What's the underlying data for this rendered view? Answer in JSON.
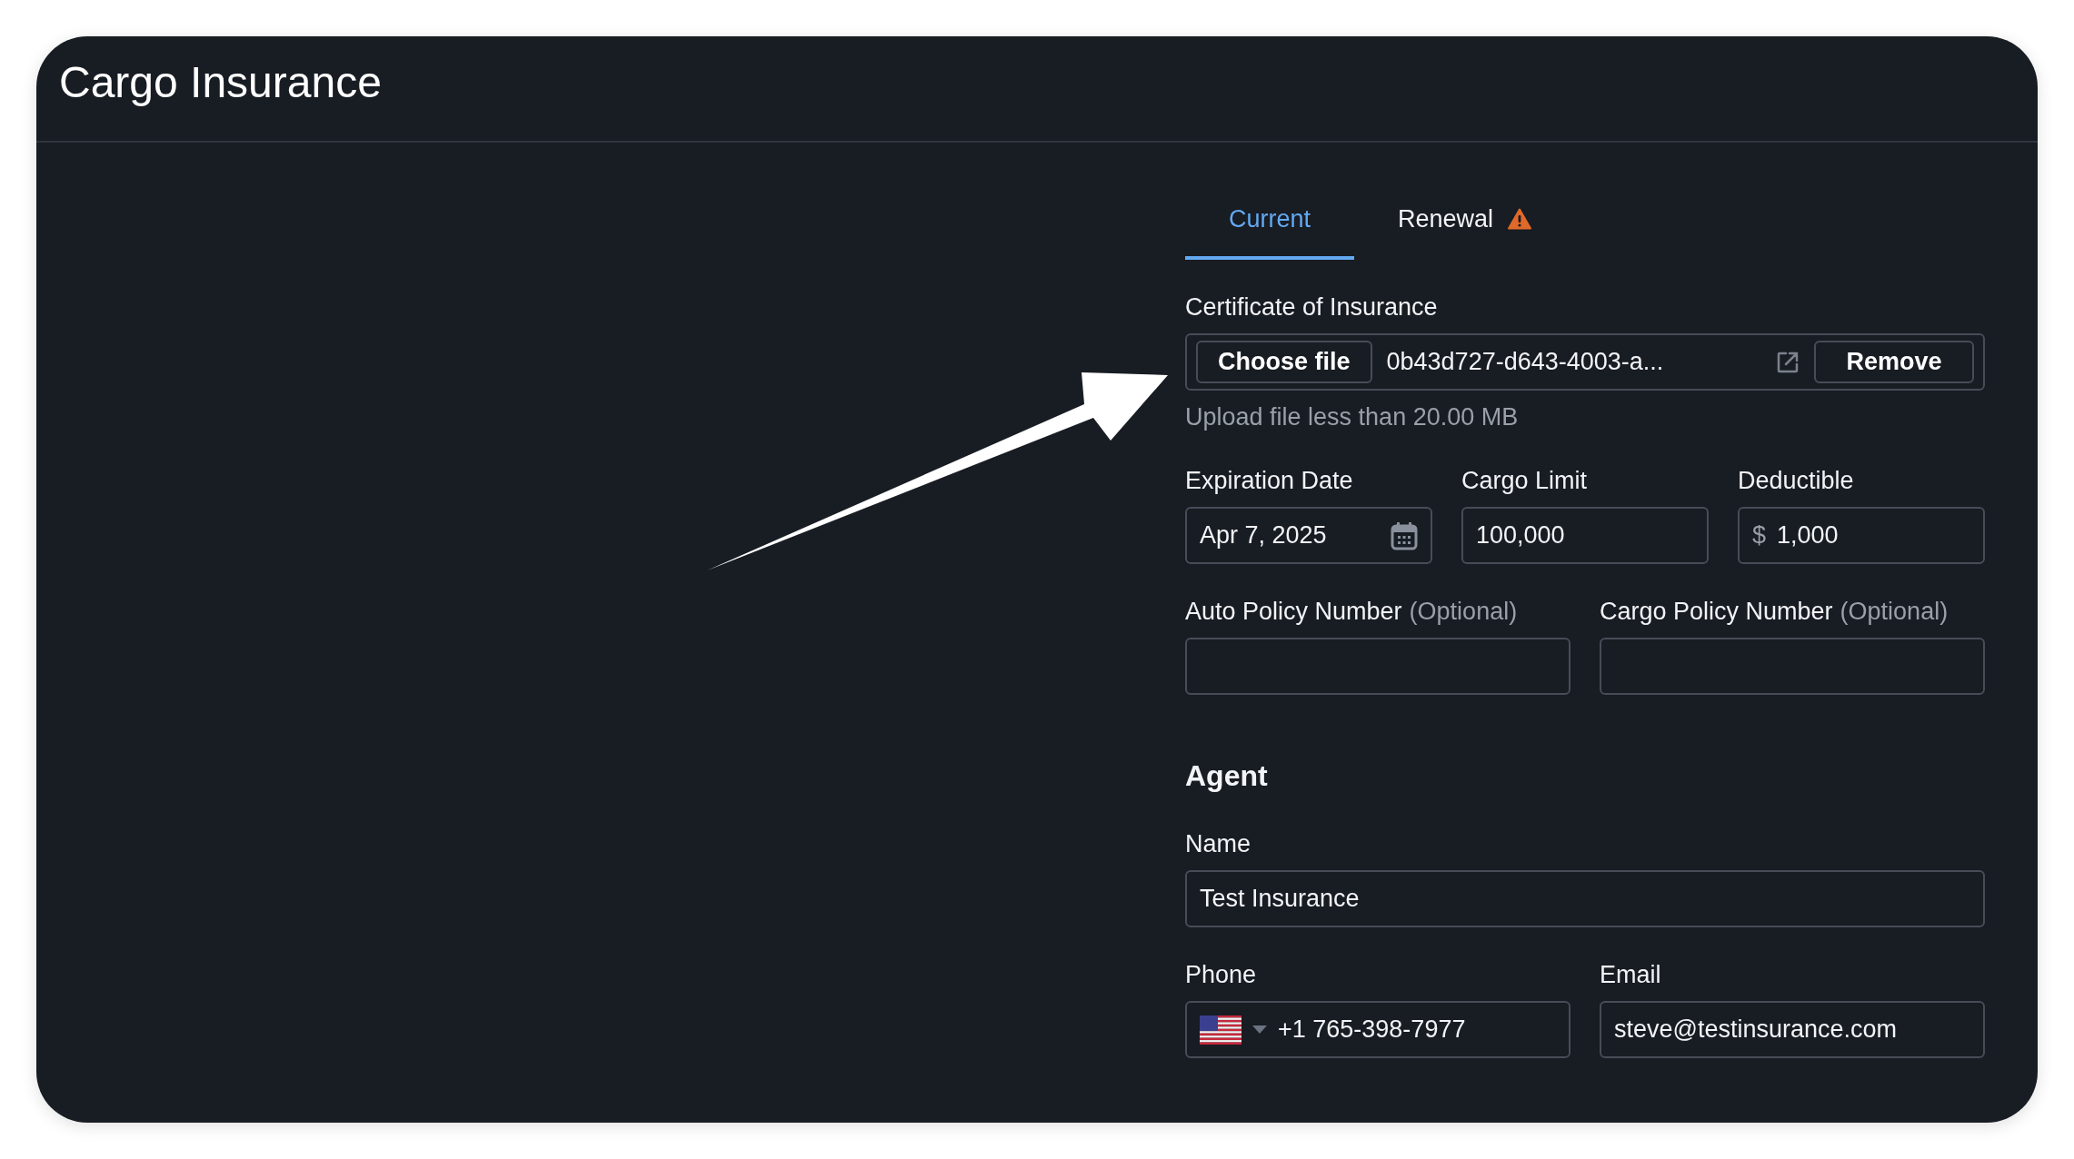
{
  "window": {
    "title": "Cargo Insurance"
  },
  "tabs": [
    {
      "label": "Current",
      "selected": true,
      "warning": false
    },
    {
      "label": "Renewal",
      "selected": false,
      "warning": true
    }
  ],
  "certificate": {
    "label": "Certificate of Insurance",
    "choose_button": "Choose file",
    "file_name": "0b43d727-d643-4003-a...",
    "remove_button": "Remove",
    "hint": "Upload file less than 20.00 MB"
  },
  "rows": [
    {
      "fields": [
        {
          "kind": "date",
          "label": "Expiration Date",
          "value": "Apr 7, 2025"
        },
        {
          "kind": "text",
          "label": "Cargo Limit",
          "value": "100,000"
        },
        {
          "kind": "currency",
          "label": "Deductible",
          "prefix": "$",
          "value": "1,000"
        }
      ]
    },
    {
      "fields": [
        {
          "kind": "text",
          "label": "Auto Policy Number",
          "note": "(Optional)"
        },
        {
          "kind": "text",
          "label": "Cargo Policy Number",
          "note": "(Optional)"
        }
      ]
    }
  ],
  "agent": {
    "heading": "Agent",
    "rows": [
      {
        "fields": [
          {
            "kind": "text",
            "label": "Name",
            "value": "Test Insurance"
          }
        ]
      },
      {
        "fields": [
          {
            "kind": "phone",
            "label": "Phone",
            "value": "+1 765-398-7977"
          },
          {
            "kind": "text",
            "label": "Email",
            "value": "steve@testinsurance.com"
          }
        ]
      }
    ]
  }
}
